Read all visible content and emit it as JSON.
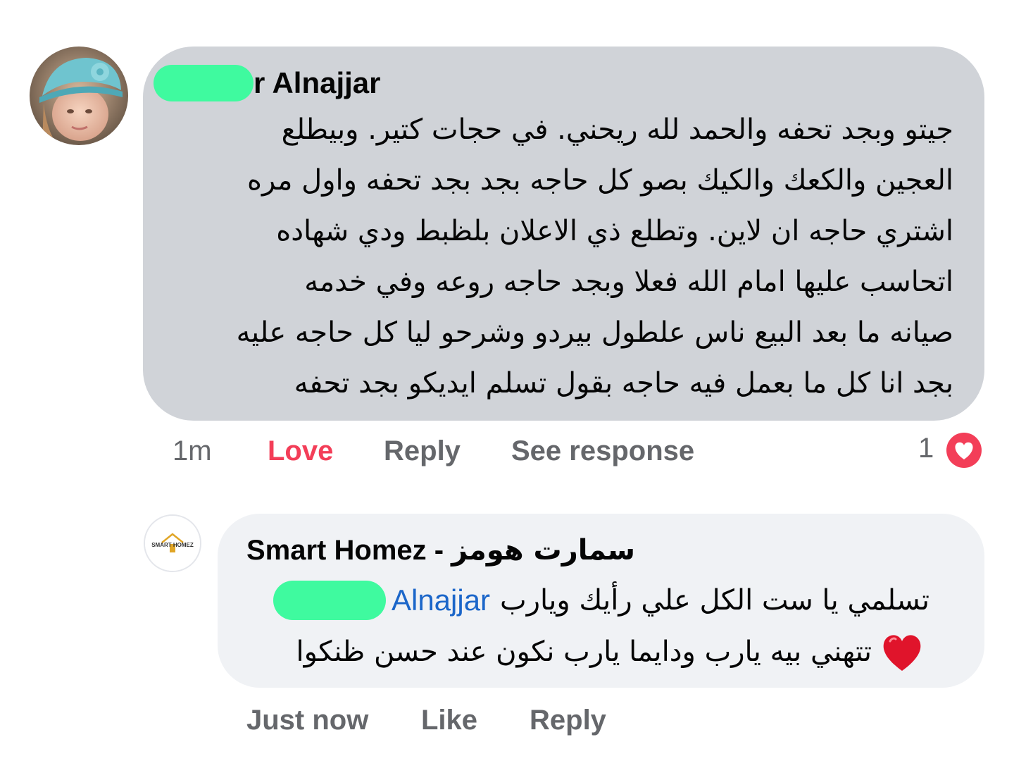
{
  "comment": {
    "author_visible_name": "r Alnajjar",
    "body_lines": [
      "جيتو وبجد تحفه والحمد لله ريحني. في حجات كتير. وبيطلع",
      "العجين والكعك والكيك بصو كل حاجه بجد بجد تحفه واول مره",
      "اشتري حاجه ان لاين. وتطلع ذي الاعلان بلظبط ودي شهاده",
      "اتحاسب عليها امام الله فعلا وبجد حاجه روعه وفي خدمه",
      "صيانه ما بعد البيع ناس علطول بيردو وشرحو ليا كل حاجه عليه",
      "بجد انا كل ما بعمل فيه حاجه بقول تسلم ايديكو بجد تحفه"
    ],
    "actions": {
      "time": "1m",
      "love": "Love",
      "reply": "Reply",
      "see_response": "See response"
    },
    "reaction_count": "1",
    "colors": {
      "bubble": "#d0d3d8",
      "love": "#f33e58",
      "censor_mark": "#3ffa9f"
    }
  },
  "reply": {
    "avatar_logo_text": "SMART HOMEZ",
    "author_name_en": "Smart Homez - ",
    "author_name_ar": "سمارت هومز",
    "line1_arabic": "تسلمي يا ست الكل علي رأيك ويارب",
    "mention": "Alnajjar",
    "line2_arabic": "تتهني بيه يارب ودايما يارب نكون عند حسن ظنكوا",
    "emoji": "red-heart",
    "actions": {
      "time": "Just now",
      "like": "Like",
      "reply": "Reply"
    },
    "colors": {
      "bubble": "#f0f2f5",
      "mention": "#1b66c9"
    }
  }
}
